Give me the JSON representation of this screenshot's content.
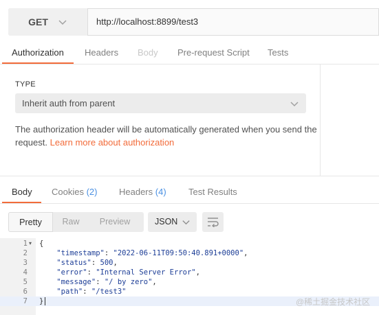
{
  "request": {
    "method": "GET",
    "url": "http://localhost:8899/test3",
    "tabs": [
      "Authorization",
      "Headers",
      "Body",
      "Pre-request Script",
      "Tests"
    ],
    "active_tab": "Authorization"
  },
  "auth": {
    "type_label": "TYPE",
    "selected_type": "Inherit auth from parent",
    "description": "The authorization header will be automatically generated when you send the request.",
    "link_text": "Learn more about authorization"
  },
  "response": {
    "tabs": {
      "body": "Body",
      "cookies": "Cookies",
      "cookies_count": "(2)",
      "headers": "Headers",
      "headers_count": "(4)",
      "test_results": "Test Results"
    },
    "views": [
      "Pretty",
      "Raw",
      "Preview"
    ],
    "active_view": "Pretty",
    "format": "JSON",
    "line_numbers": [
      "1",
      "2",
      "3",
      "4",
      "5",
      "6",
      "7"
    ],
    "code": {
      "open": "{",
      "timestamp_key": "\"timestamp\"",
      "timestamp_val": "\"2022-06-11T09:50:40.891+0000\"",
      "status_key": "\"status\"",
      "status_val": "500",
      "error_key": "\"error\"",
      "error_val": "\"Internal Server Error\"",
      "message_key": "\"message\"",
      "message_val": "\"/ by zero\"",
      "path_key": "\"path\"",
      "path_val": "\"/test3\"",
      "close": "}"
    }
  },
  "watermark": "@稀土掘金技术社区",
  "colors": {
    "accent": "#f26b3a",
    "link_blue": "#4a90e2"
  }
}
